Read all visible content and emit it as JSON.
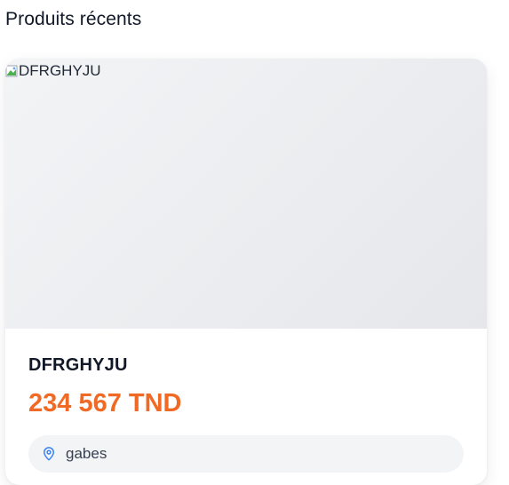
{
  "section": {
    "title": "Produits récents"
  },
  "product": {
    "image_alt": "DFRGHYJU",
    "name": "DFRGHYJU",
    "price": "234 567 TND",
    "location": "gabes",
    "location_icon": "map-pin-icon"
  },
  "colors": {
    "price": "#f06a25",
    "pin": "#3b82f6",
    "image_placeholder": "#e5e7eb",
    "pill_background": "#f3f4f6"
  }
}
